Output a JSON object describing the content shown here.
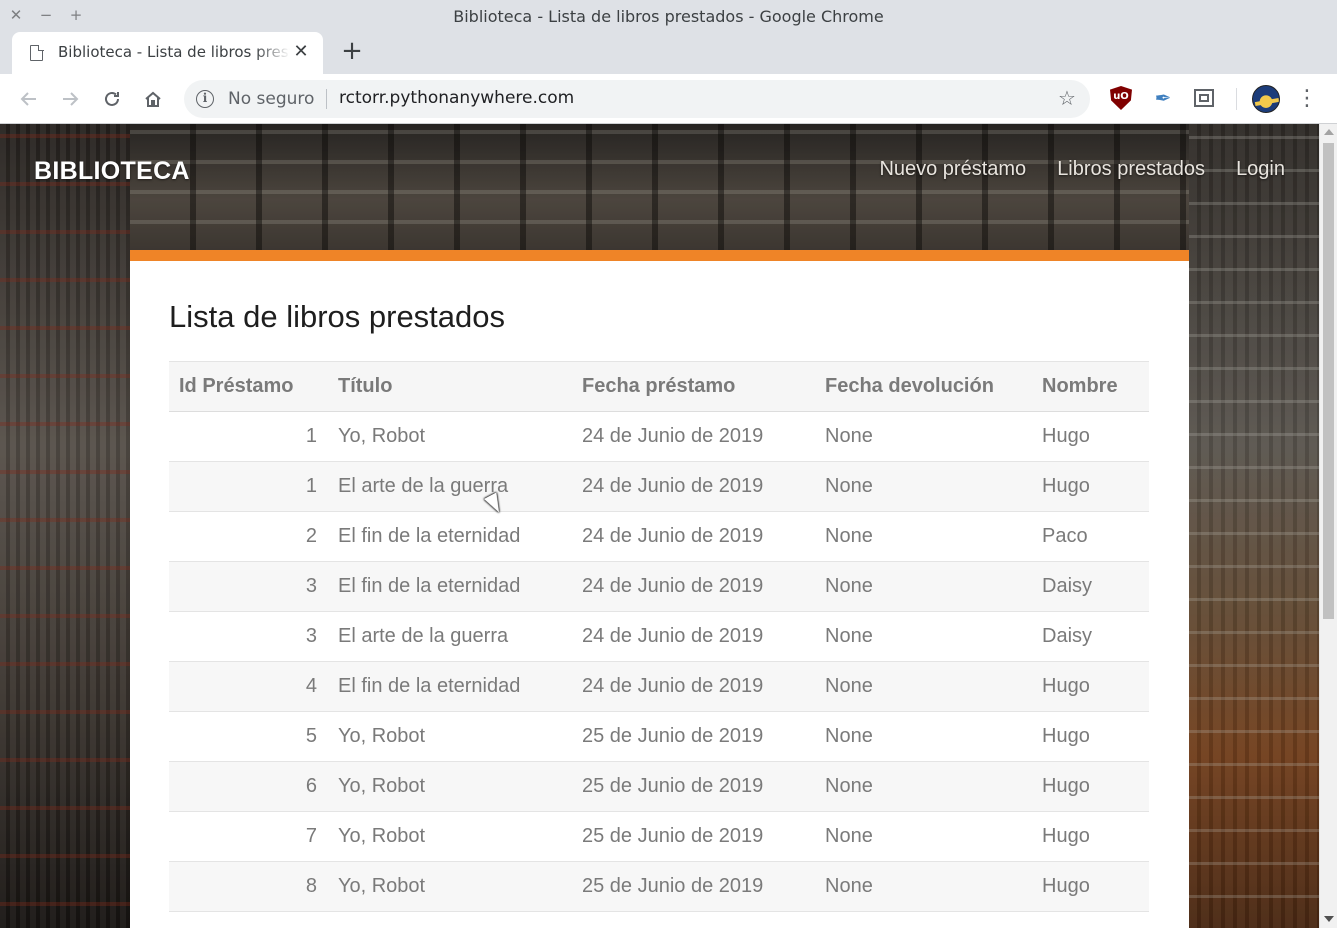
{
  "window": {
    "title": "Biblioteca - Lista de libros prestados - Google Chrome",
    "controls": {
      "close": "✕",
      "minimize": "−",
      "maximize": "+"
    }
  },
  "tab": {
    "title": "Biblioteca - Lista de libros prestados",
    "close_glyph": "✕",
    "new_tab_glyph": "+"
  },
  "toolbar": {
    "security_label": "No seguro",
    "url": "rctorr.pythonanywhere.com",
    "icons": [
      "back-icon",
      "forward-icon",
      "reload-icon",
      "home-icon",
      "info-icon",
      "star-icon",
      "ublock-icon",
      "feather-icon",
      "screenshot-icon",
      "avatar",
      "menu-icon"
    ]
  },
  "site": {
    "brand": "BIBLIOTECA",
    "nav": [
      "Nuevo préstamo",
      "Libros prestados",
      "Login"
    ],
    "accent_color": "#ef8427"
  },
  "page": {
    "title": "Lista de libros prestados",
    "table": {
      "headers": [
        "Id Préstamo",
        "Título",
        "Fecha préstamo",
        "Fecha devolución",
        "Nombre"
      ],
      "rows": [
        [
          "1",
          "Yo, Robot",
          "24 de Junio de 2019",
          "None",
          "Hugo"
        ],
        [
          "1",
          "El arte de la guerra",
          "24 de Junio de 2019",
          "None",
          "Hugo"
        ],
        [
          "2",
          "El fin de la eternidad",
          "24 de Junio de 2019",
          "None",
          "Paco"
        ],
        [
          "3",
          "El fin de la eternidad",
          "24 de Junio de 2019",
          "None",
          "Daisy"
        ],
        [
          "3",
          "El arte de la guerra",
          "24 de Junio de 2019",
          "None",
          "Daisy"
        ],
        [
          "4",
          "El fin de la eternidad",
          "24 de Junio de 2019",
          "None",
          "Hugo"
        ],
        [
          "5",
          "Yo, Robot",
          "25 de Junio de 2019",
          "None",
          "Hugo"
        ],
        [
          "6",
          "Yo, Robot",
          "25 de Junio de 2019",
          "None",
          "Hugo"
        ],
        [
          "7",
          "Yo, Robot",
          "25 de Junio de 2019",
          "None",
          "Hugo"
        ],
        [
          "8",
          "Yo, Robot",
          "25 de Junio de 2019",
          "None",
          "Hugo"
        ]
      ]
    }
  }
}
